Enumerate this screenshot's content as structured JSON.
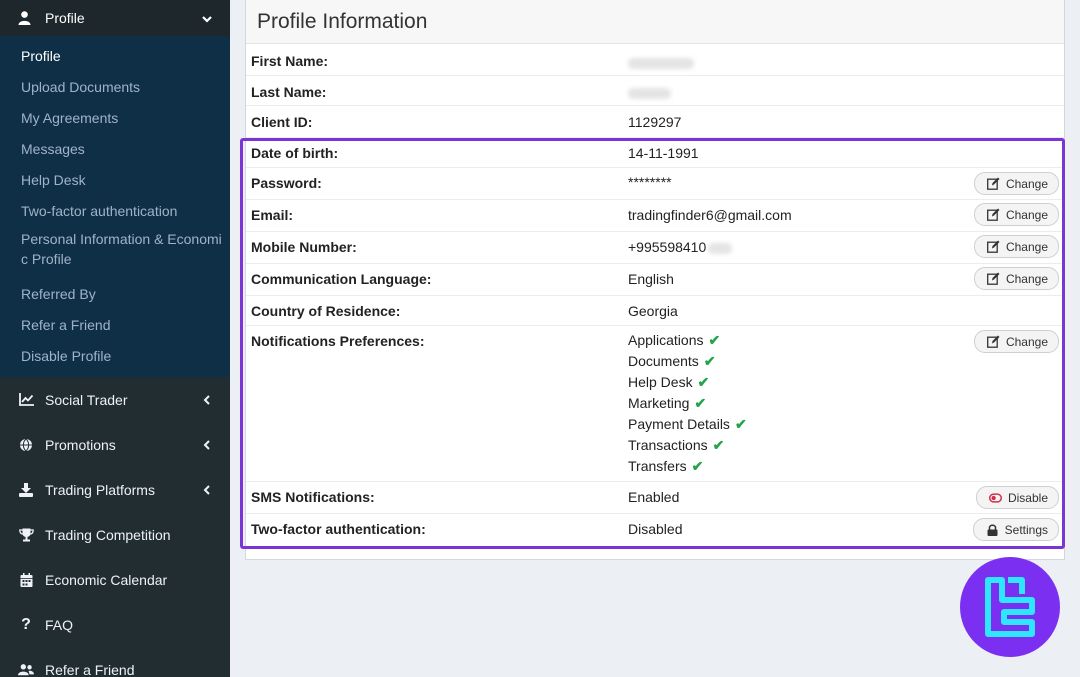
{
  "sidebar": {
    "section": {
      "label": "Profile",
      "icon": "user-icon"
    },
    "subitems": [
      {
        "label": "Profile",
        "active": true
      },
      {
        "label": "Upload Documents"
      },
      {
        "label": "My Agreements"
      },
      {
        "label": "Messages"
      },
      {
        "label": "Help Desk"
      },
      {
        "label": "Two-factor authentication"
      },
      {
        "label": "Personal Information & Economi c Profile"
      },
      {
        "label": "Referred By"
      },
      {
        "label": "Refer a Friend"
      },
      {
        "label": "Disable Profile"
      }
    ],
    "nav": [
      {
        "label": "Social Trader",
        "icon": "chart-line-icon",
        "has_submenu": true
      },
      {
        "label": "Promotions",
        "icon": "globe-icon",
        "has_submenu": true
      },
      {
        "label": "Trading Platforms",
        "icon": "download-icon",
        "has_submenu": true
      },
      {
        "label": "Trading Competition",
        "icon": "trophy-icon"
      },
      {
        "label": "Economic Calendar",
        "icon": "calendar-icon"
      },
      {
        "label": "FAQ",
        "icon": "question-icon"
      },
      {
        "label": "Refer a Friend",
        "icon": "users-icon"
      }
    ]
  },
  "profile": {
    "title": "Profile Information",
    "rows": [
      {
        "label": "First Name:",
        "value": ""
      },
      {
        "label": "Last Name:",
        "value": ""
      },
      {
        "label": "Client ID:",
        "value": "1129297"
      },
      {
        "label": "Date of birth:",
        "value": "14-11-1991"
      },
      {
        "label": "Password:",
        "value": "********",
        "button": "Change"
      },
      {
        "label": "Email:",
        "value": "tradingfinder6@gmail.com",
        "button": "Change"
      },
      {
        "label": "Mobile Number:",
        "value": "+995598410",
        "button": "Change"
      },
      {
        "label": "Communication Language:",
        "value": "English",
        "button": "Change"
      },
      {
        "label": "Country of Residence:",
        "value": "Georgia"
      },
      {
        "label": "Notifications Preferences:",
        "values": [
          "Applications",
          "Documents",
          "Help Desk",
          "Marketing",
          "Payment Details",
          "Transactions",
          "Transfers"
        ],
        "button": "Change"
      },
      {
        "label": "SMS Notifications:",
        "value": "Enabled",
        "button": "Disable"
      },
      {
        "label": "Two-factor authentication:",
        "value": "Disabled",
        "button": "Settings"
      }
    ]
  },
  "colors": {
    "sidebar_bg": "#222d32",
    "submenu_bg": "#0f2f47",
    "highlight": "#7b35d6",
    "check": "#23a44a",
    "logo_bg": "#7b2ff0",
    "logo_fg": "#2fe6ff"
  }
}
